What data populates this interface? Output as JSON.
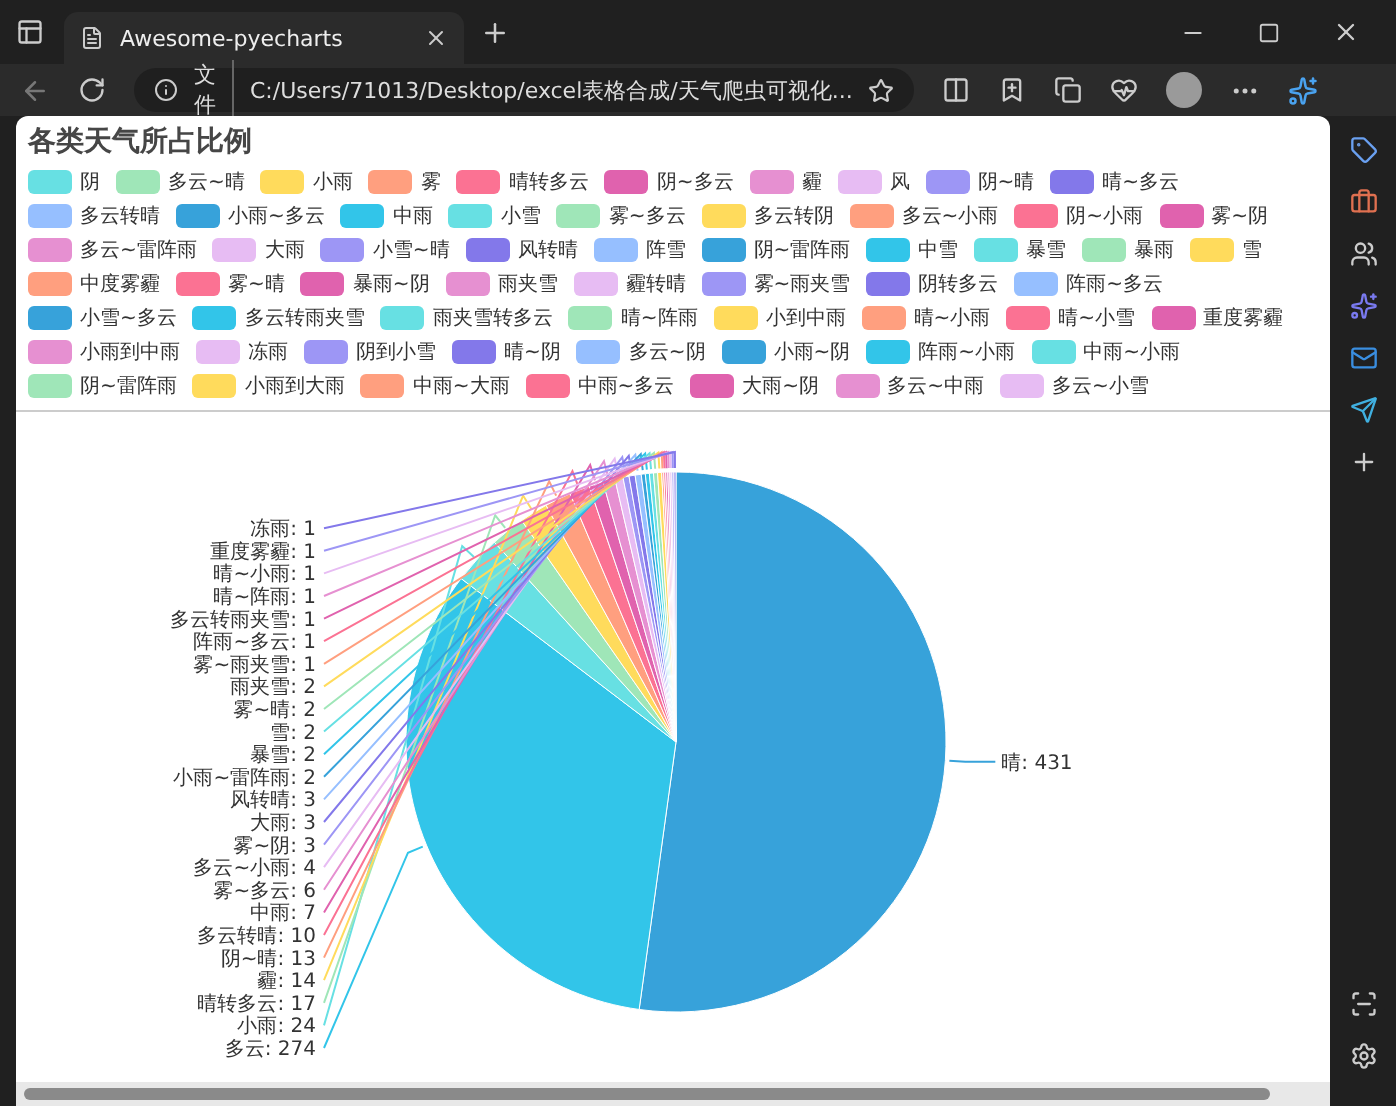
{
  "browser": {
    "tab_title": "Awesome-pyecharts",
    "address_prefix": "文件",
    "url": "C:/Users/71013/Desktop/excel表格合成/天气爬虫可视化..."
  },
  "chart": {
    "title": "各类天气所占比例",
    "legend": [
      {
        "label": "阴",
        "color": "#67E0E3"
      },
      {
        "label": "多云~晴",
        "color": "#9FE6B8"
      },
      {
        "label": "小雨",
        "color": "#FFDB5C"
      },
      {
        "label": "雾",
        "color": "#ff9f7f"
      },
      {
        "label": "晴转多云",
        "color": "#fb7293"
      },
      {
        "label": "阴~多云",
        "color": "#E062AE"
      },
      {
        "label": "霾",
        "color": "#E690D1"
      },
      {
        "label": "风",
        "color": "#e7bcf3"
      },
      {
        "label": "阴~晴",
        "color": "#9d96f5"
      },
      {
        "label": "晴~多云",
        "color": "#8378EA"
      },
      {
        "label": "多云转晴",
        "color": "#96BFFF"
      },
      {
        "label": "小雨~多云",
        "color": "#37A2DA"
      },
      {
        "label": "中雨",
        "color": "#32C5E9"
      },
      {
        "label": "小雪",
        "color": "#67E0E3"
      },
      {
        "label": "雾~多云",
        "color": "#9FE6B8"
      },
      {
        "label": "多云转阴",
        "color": "#FFDB5C"
      },
      {
        "label": "多云~小雨",
        "color": "#ff9f7f"
      },
      {
        "label": "阴~小雨",
        "color": "#fb7293"
      },
      {
        "label": "雾~阴",
        "color": "#E062AE"
      },
      {
        "label": "多云~雷阵雨",
        "color": "#E690D1"
      },
      {
        "label": "大雨",
        "color": "#e7bcf3"
      },
      {
        "label": "小雪~晴",
        "color": "#9d96f5"
      },
      {
        "label": "风转晴",
        "color": "#8378EA"
      },
      {
        "label": "阵雪",
        "color": "#96BFFF"
      },
      {
        "label": "阴~雷阵雨",
        "color": "#37A2DA"
      },
      {
        "label": "中雪",
        "color": "#32C5E9"
      },
      {
        "label": "暴雪",
        "color": "#67E0E3"
      },
      {
        "label": "暴雨",
        "color": "#9FE6B8"
      },
      {
        "label": "雪",
        "color": "#FFDB5C"
      },
      {
        "label": "中度雾霾",
        "color": "#ff9f7f"
      },
      {
        "label": "雾~晴",
        "color": "#fb7293"
      },
      {
        "label": "暴雨~阴",
        "color": "#E062AE"
      },
      {
        "label": "雨夹雪",
        "color": "#E690D1"
      },
      {
        "label": "霾转晴",
        "color": "#e7bcf3"
      },
      {
        "label": "雾~雨夹雪",
        "color": "#9d96f5"
      },
      {
        "label": "阴转多云",
        "color": "#8378EA"
      },
      {
        "label": "阵雨~多云",
        "color": "#96BFFF"
      },
      {
        "label": "小雪~多云",
        "color": "#37A2DA"
      },
      {
        "label": "多云转雨夹雪",
        "color": "#32C5E9"
      },
      {
        "label": "雨夹雪转多云",
        "color": "#67E0E3"
      },
      {
        "label": "晴~阵雨",
        "color": "#9FE6B8"
      },
      {
        "label": "小到中雨",
        "color": "#FFDB5C"
      },
      {
        "label": "晴~小雨",
        "color": "#ff9f7f"
      },
      {
        "label": "晴~小雪",
        "color": "#fb7293"
      },
      {
        "label": "重度雾霾",
        "color": "#E062AE"
      },
      {
        "label": "小雨到中雨",
        "color": "#E690D1"
      },
      {
        "label": "冻雨",
        "color": "#e7bcf3"
      },
      {
        "label": "阴到小雪",
        "color": "#9d96f5"
      },
      {
        "label": "晴~阴",
        "color": "#8378EA"
      },
      {
        "label": "多云~阴",
        "color": "#96BFFF"
      },
      {
        "label": "小雨~阴",
        "color": "#37A2DA"
      },
      {
        "label": "阵雨~小雨",
        "color": "#32C5E9"
      },
      {
        "label": "中雨~小雨",
        "color": "#67E0E3"
      },
      {
        "label": "阴~雷阵雨",
        "color": "#9FE6B8"
      },
      {
        "label": "小雨到大雨",
        "color": "#FFDB5C"
      },
      {
        "label": "中雨~大雨",
        "color": "#ff9f7f"
      },
      {
        "label": "中雨~多云",
        "color": "#fb7293"
      },
      {
        "label": "大雨~阴",
        "color": "#E062AE"
      },
      {
        "label": "多云~中雨",
        "color": "#E690D1"
      },
      {
        "label": "多云~小雪",
        "color": "#e7bcf3"
      }
    ],
    "chart_data": {
      "type": "pie",
      "values": [
        431,
        274,
        24,
        17,
        14,
        13,
        10,
        7,
        6,
        4,
        3,
        3,
        3,
        2,
        2,
        2,
        2,
        2,
        1,
        1,
        1,
        1,
        1,
        1,
        1
      ],
      "value_labels": [
        "晴: 431",
        "多云: 274",
        "小雨: 24",
        "晴转多云: 17",
        "霾: 14",
        "阴~晴: 13",
        "多云转晴: 10",
        "中雨: 7",
        "雾~多云: 6",
        "多云~小雨: 4",
        "雾~阴: 3",
        "大雨: 3",
        "风转晴: 3",
        "小雨~雷阵雨: 2",
        "暴雪: 2",
        "雪: 2",
        "雾~晴: 2",
        "雨夹雪: 2",
        "雾~雨夹雪: 1",
        "阵雨~多云: 1",
        "多云转雨夹雪: 1",
        "晴~阵雨: 1",
        "晴~小雨: 1",
        "重度雾霾: 1",
        "冻雨: 1"
      ]
    }
  }
}
